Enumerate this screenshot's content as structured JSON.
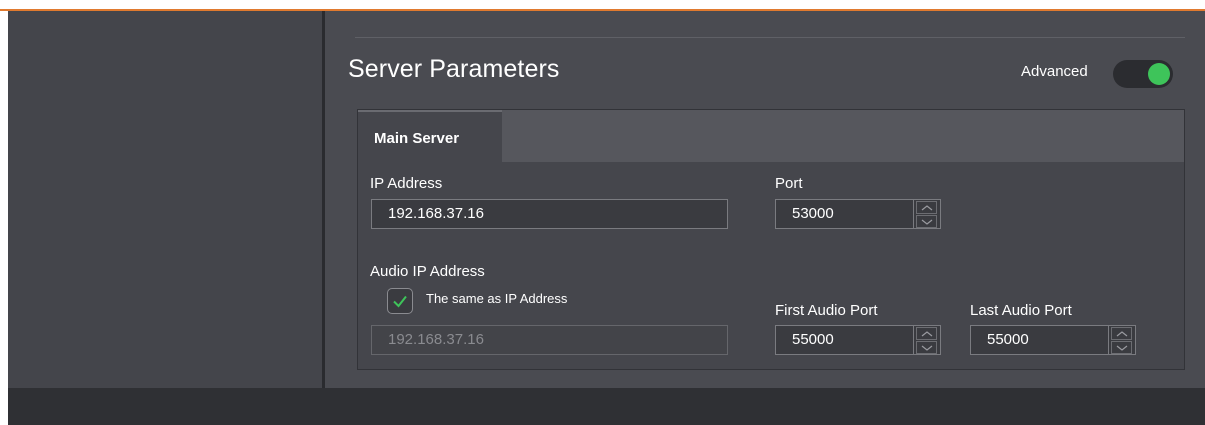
{
  "section_title": "Server Parameters",
  "advanced": {
    "label": "Advanced",
    "enabled": true,
    "accent": "#3ec45a"
  },
  "tabs": [
    {
      "label": "Main Server",
      "active": true
    }
  ],
  "main_server": {
    "ip_label": "IP Address",
    "ip_value": "192.168.37.16",
    "port_label": "Port",
    "port_value": "53000",
    "audio_ip_label": "Audio IP Address",
    "same_as_ip_label": "The same as IP Address",
    "same_as_ip_checked": true,
    "audio_ip_value": "192.168.37.16",
    "first_audio_port_label": "First Audio Port",
    "first_audio_port_value": "55000",
    "last_audio_port_label": "Last Audio Port",
    "last_audio_port_value": "55000"
  },
  "icons": {
    "toggle": "toggle-switch-icon",
    "check": "checkmark-icon",
    "spin_up": "chevron-up-icon",
    "spin_down": "chevron-down-icon"
  },
  "colors": {
    "accent_orange": "#e07a2f",
    "check_green": "#3ec45a"
  }
}
